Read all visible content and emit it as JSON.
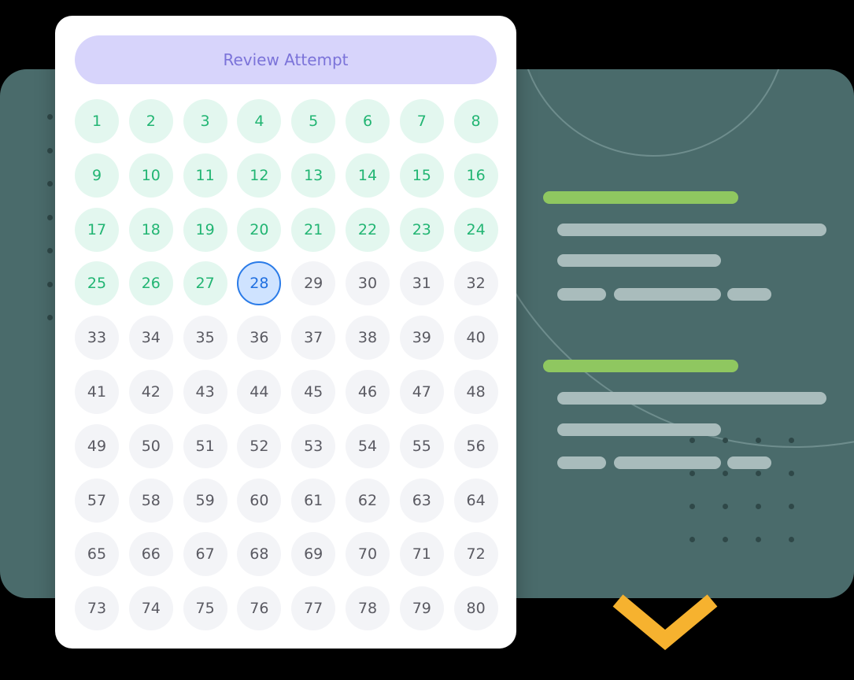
{
  "review_button": {
    "label": "Review Attempt"
  },
  "questions": {
    "total": 80,
    "answered_count": 27,
    "current": 28
  },
  "colors": {
    "panel": "#4a6b6b",
    "accent_green": "#8fc760",
    "line_gray": "#a9bcbc",
    "button_bg": "#d7d4fb",
    "button_text": "#7b73d9",
    "answered_bg": "#e3f7ef",
    "answered_text": "#22b573",
    "current_bg": "#cfe3ff",
    "current_border": "#2a7be8",
    "unanswered_bg": "#f3f4f7",
    "chevron": "#f6b22f"
  }
}
